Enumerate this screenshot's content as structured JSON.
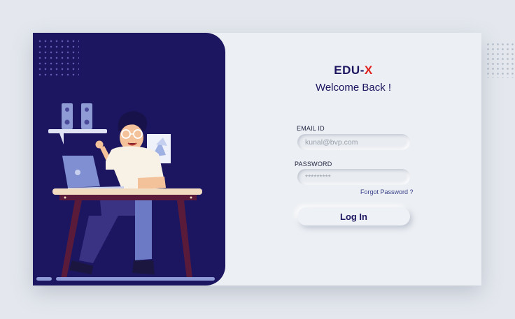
{
  "brand": {
    "name_part": "EDU-",
    "name_accent": "X",
    "accent_color": "#e0201b",
    "primary_color": "#1c1660"
  },
  "welcome_text": "Welcome Back !",
  "form": {
    "email_label": "EMAIL ID",
    "email_placeholder": "kunal@bvp.com",
    "password_label": "PASSWORD",
    "password_placeholder": "*********",
    "forgot_label": "Forgot Password ?",
    "login_label": "Log In"
  },
  "illustration": {
    "subject": "person working at laptop on desk",
    "panel_color": "#1c1660"
  }
}
